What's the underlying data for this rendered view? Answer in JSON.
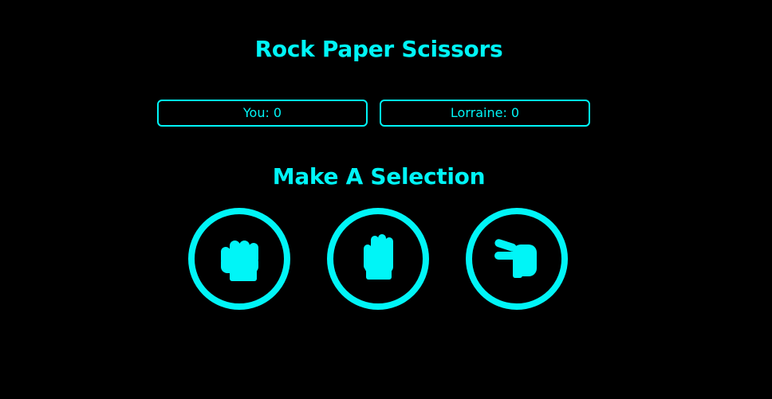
{
  "header": {
    "title": "Rock Paper Scissors"
  },
  "scores": {
    "you": "You: 0",
    "opponent": "Lorraine: 0"
  },
  "selection": {
    "prompt": "Make A Selection",
    "options": [
      {
        "icon": "hand-rock-icon"
      },
      {
        "icon": "hand-paper-icon"
      },
      {
        "icon": "hand-scissors-icon"
      }
    ]
  },
  "colors": {
    "accent": "#00f5f7",
    "background": "#000000"
  }
}
